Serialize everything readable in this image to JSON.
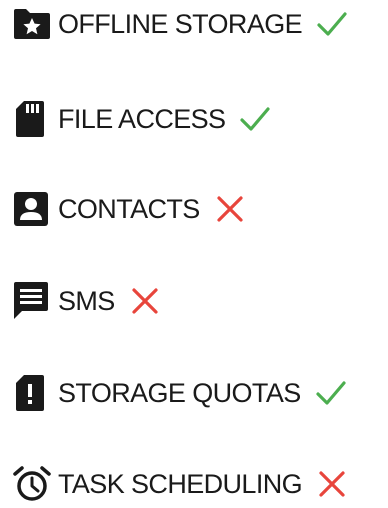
{
  "features": [
    {
      "label": "OFFLINE STORAGE",
      "icon": "folder-star-icon",
      "status": "supported"
    },
    {
      "label": "FILE ACCESS",
      "icon": "sd-card-icon",
      "status": "supported"
    },
    {
      "label": "CONTACTS",
      "icon": "contact-card-icon",
      "status": "unsupported"
    },
    {
      "label": "SMS",
      "icon": "message-icon",
      "status": "unsupported"
    },
    {
      "label": "STORAGE QUOTAS",
      "icon": "sd-card-alert-icon",
      "status": "supported"
    },
    {
      "label": "TASK SCHEDULING",
      "icon": "alarm-clock-icon",
      "status": "unsupported"
    }
  ],
  "colors": {
    "icon": "#1a1a1a",
    "text": "#1a1a1a",
    "supported": "#4cae4f",
    "unsupported": "#e8453c"
  }
}
